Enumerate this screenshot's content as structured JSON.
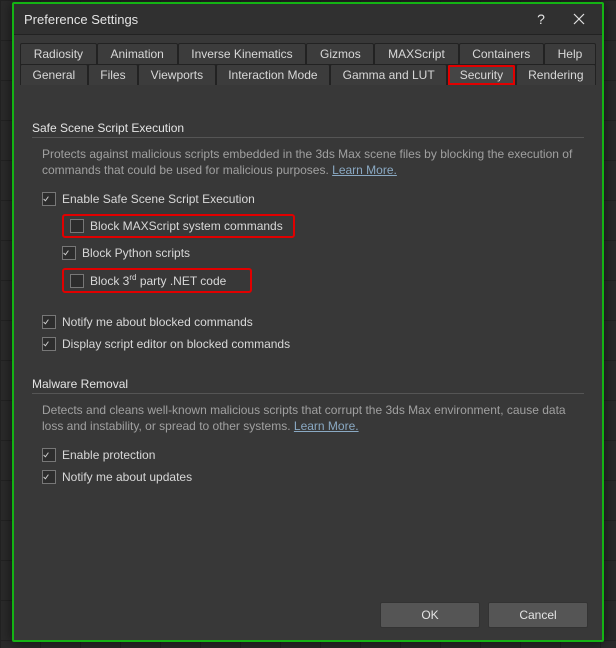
{
  "window": {
    "title": "Preference Settings"
  },
  "tabs": {
    "row1": [
      {
        "label": "Radiosity"
      },
      {
        "label": "Animation"
      },
      {
        "label": "Inverse Kinematics"
      },
      {
        "label": "Gizmos"
      },
      {
        "label": "MAXScript"
      },
      {
        "label": "Containers"
      },
      {
        "label": "Help"
      }
    ],
    "row2": [
      {
        "label": "General"
      },
      {
        "label": "Files"
      },
      {
        "label": "Viewports"
      },
      {
        "label": "Interaction Mode"
      },
      {
        "label": "Gamma and LUT"
      },
      {
        "label": "Security",
        "active": true,
        "highlighted": true
      },
      {
        "label": "Rendering"
      }
    ]
  },
  "safeScene": {
    "title": "Safe Scene Script Execution",
    "desc": "Protects against malicious scripts embedded in the 3ds Max scene files by blocking the execution of commands that could be used for malicious purposes. ",
    "learnMore": "Learn More.",
    "enable": {
      "label": "Enable Safe Scene Script Execution",
      "checked": true
    },
    "blockMax": {
      "label": "Block MAXScript system commands",
      "checked": false,
      "highlighted": true
    },
    "blockPython": {
      "label": "Block Python scripts",
      "checked": true
    },
    "blockDotNet": {
      "label": "Block 3",
      "labelSup": "rd",
      "labelRest": " party .NET code",
      "checked": false,
      "highlighted": true
    },
    "notifyBlocked": {
      "label": "Notify me about blocked commands",
      "checked": true
    },
    "displayEditor": {
      "label": "Display script editor on blocked commands",
      "checked": true
    }
  },
  "malware": {
    "title": "Malware Removal",
    "desc": "Detects and cleans well-known malicious scripts that corrupt the 3ds Max environment, cause data loss and instability, or spread to other systems. ",
    "learnMore": "Learn More.",
    "enable": {
      "label": "Enable protection",
      "checked": true
    },
    "notify": {
      "label": "Notify me about updates",
      "checked": true
    }
  },
  "footer": {
    "ok": "OK",
    "cancel": "Cancel"
  }
}
